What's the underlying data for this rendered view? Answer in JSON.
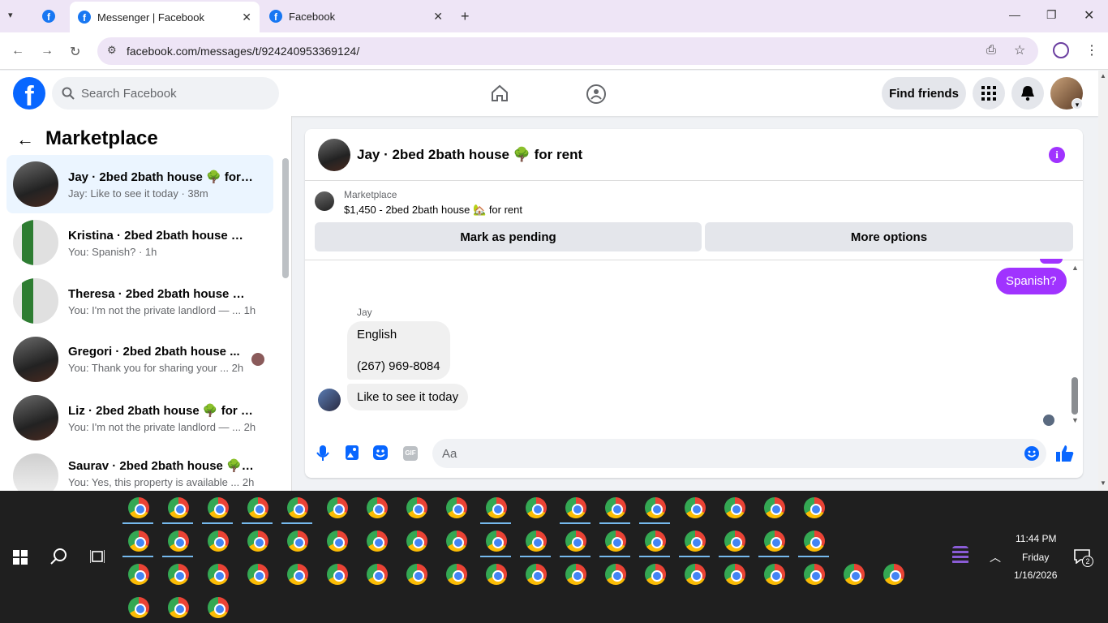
{
  "browser": {
    "tabs": [
      {
        "title": "Messenger | Facebook"
      },
      {
        "title": "Facebook"
      }
    ],
    "url": "facebook.com/messages/t/924240953369124/"
  },
  "header": {
    "search_placeholder": "Search Facebook",
    "find_friends": "Find friends"
  },
  "sidebar": {
    "title": "Marketplace",
    "conversations": [
      {
        "name": "Jay · 2bed 2bath house 🌳 for re...",
        "snippet": "Jay: Like to see it today · 38m"
      },
      {
        "name": "Kristina · 2bed 2bath house 🌳 f...",
        "snippet": "You: Spanish? · 1h"
      },
      {
        "name": "Theresa · 2bed 2bath house 🌳 f...",
        "snippet": "You: I'm not the private landlord — ... 1h"
      },
      {
        "name": "Gregori · 2bed 2bath house ...",
        "snippet": "You: Thank you for sharing your ... 2h"
      },
      {
        "name": "Liz · 2bed 2bath house 🌳 for rent",
        "snippet": "You: I'm not the private landlord — ... 2h"
      },
      {
        "name": "Saurav · 2bed 2bath house 🌳 fo...",
        "snippet": "You: Yes, this property is available ... 2h"
      }
    ]
  },
  "chat": {
    "title": "Jay · 2bed 2bath house 🌳 for rent",
    "marketplace_label": "Marketplace",
    "listing": "$1,450 - 2bed 2bath house 🏡 for rent",
    "mark_pending": "Mark as pending",
    "more_options": "More options",
    "messages": {
      "outgoing": "Spanish?",
      "sender": "Jay",
      "incoming_1_line1": "English",
      "incoming_1_line2": "(267) 969-8084",
      "incoming_2": "Like to see it today"
    },
    "input_placeholder": "Aa"
  },
  "taskbar": {
    "time": "11:44 PM",
    "day": "Friday",
    "date": "1/16/2026",
    "notification_count": "2"
  },
  "colors": {
    "fb_blue": "#0866ff",
    "messenger_purple": "#a033ff",
    "taskbar": "#1f1f1f"
  }
}
